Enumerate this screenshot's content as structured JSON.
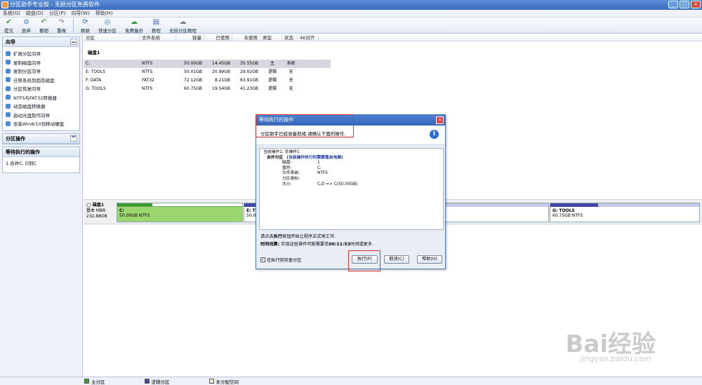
{
  "window": {
    "title": "分区助手专业版 - 无损分区免费软件",
    "controls": [
      "_",
      "□",
      "×"
    ]
  },
  "menu": [
    "系统(G)",
    "磁盘(D)",
    "分区(P)",
    "向导(W)",
    "帮助(H)"
  ],
  "toolbar": [
    {
      "label": "提交",
      "icon": "✔",
      "color": "#2a9a2a"
    },
    {
      "label": "放弃",
      "icon": "⊘",
      "color": "#2d6fc6"
    },
    {
      "label": "撤销",
      "icon": "↶",
      "color": "#2a8a3a"
    },
    {
      "label": "重做",
      "icon": "↷",
      "color": "#7a7a7a"
    },
    {
      "label": "刷新",
      "icon": "⟳",
      "color": "#2d6fc6"
    },
    {
      "label": "快速分区",
      "icon": "◎",
      "color": "#2a7fb0"
    },
    {
      "label": "免费备份",
      "icon": "☁",
      "color": "#3a9a3a"
    },
    {
      "label": "教程",
      "icon": "▤",
      "color": "#355fa8"
    },
    {
      "label": "无损分区教程",
      "icon": "☁",
      "color": "#7a7a7a"
    }
  ],
  "sidebar": {
    "wizard": {
      "title": "向导",
      "items": [
        "扩展分区向导",
        "复制磁盘向导",
        "复制分区向导",
        "迁移系统到固态磁盘",
        "分区恢复向导",
        "NTFS与FAT32转换器",
        "动态磁盘转换器",
        "启动光盘制作向导",
        "安装Win8/10到移动硬盘"
      ]
    },
    "partition_ops": {
      "title": "分区操作"
    },
    "pending": {
      "title": "等待执行的操作",
      "items": [
        "1.合并C, D到C"
      ]
    }
  },
  "table": {
    "headers": [
      "分区",
      "文件系统",
      "容量",
      "已使用",
      "未使用",
      "类型",
      "状态",
      "4K对齐"
    ],
    "disk_label": "磁盘1",
    "rows": [
      [
        "C:",
        "NTFS",
        "50.00GB",
        "14.45GB",
        "35.55GB",
        "主",
        "系统"
      ],
      [
        "E: TOOLS",
        "NTFS",
        "50.01GB",
        "20.99GB",
        "29.02GB",
        "逻辑",
        "无"
      ],
      [
        "F: DATA",
        "FAT32",
        "72.12GB",
        "8.21GB",
        "63.91GB",
        "逻辑",
        "无"
      ],
      [
        "G: TOOLS",
        "NTFS",
        "60.75GB",
        "19.54GB",
        "41.23GB",
        "逻辑",
        "无"
      ]
    ]
  },
  "diskmap": {
    "disk": {
      "name": "磁盘1",
      "type": "基本 MBR",
      "size": "232.88GB"
    },
    "partitions": [
      {
        "name": "C:",
        "desc": "50.00GB NTFS"
      },
      {
        "name": "E: TOO",
        "desc": "50.0"
      },
      {
        "name": "G: TOOLS",
        "desc": "60.75GB NTFS"
      }
    ]
  },
  "status": {
    "legend": [
      "主分区",
      "逻辑分区",
      "未分配空间"
    ],
    "colors": [
      "#3a9a2a",
      "#4545a5",
      "#f4ecd0"
    ]
  },
  "dialog": {
    "title": "等待执行的操作",
    "message": "分区助手已经准备就绪,请确认下面的操作.",
    "summary": "当前操作1, 总操作1",
    "op_title": "合并分区",
    "op_warning": "(当前操作执行时需要重启电脑)",
    "details": [
      {
        "k": "磁盘:",
        "v": "1"
      },
      {
        "k": "盘符:",
        "v": "C:"
      },
      {
        "k": "文件系统:",
        "v": "NTFS"
      },
      {
        "k": "分区卷标:",
        "v": ""
      },
      {
        "k": "大小:",
        "v": "C,D => C(50.00GB)"
      }
    ],
    "hint_pre": "请点击",
    "hint_bold": "执行",
    "hint_post": "按钮开始让程序正式地工作.",
    "time_label": "时间估算:",
    "time_pre": "实现这些操作可能需要花",
    "time_value": "00:11:53",
    "time_post": "时间或更多.",
    "checkbox": "在执行前检查分区",
    "buttons": {
      "execute": "执行(P)",
      "cancel": "取消(C)",
      "help": "帮助(H)"
    }
  },
  "watermark": {
    "brand": "Bai经验",
    "url": "jingyan.baidu.com"
  }
}
